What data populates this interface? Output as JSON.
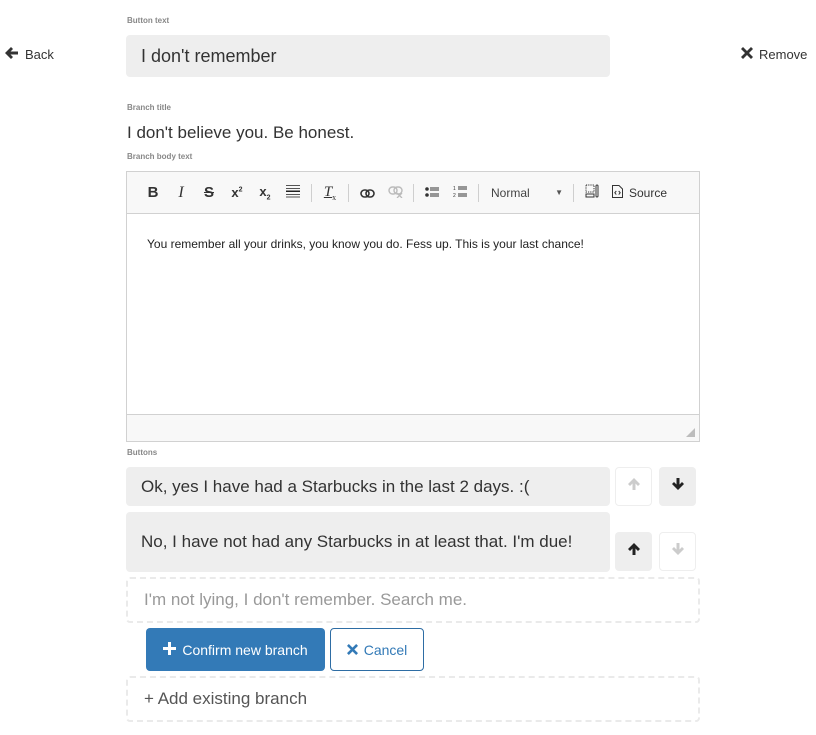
{
  "nav": {
    "back_label": "Back",
    "back_icon": "arrow-left-icon",
    "remove_label": "Remove",
    "remove_icon": "close-icon"
  },
  "form": {
    "button_text_label": "Button text",
    "button_text_value": "I don't remember",
    "branch_title_label": "Branch title",
    "branch_title_value": "I don't believe you. Be honest.",
    "branch_body_label": "Branch body text",
    "buttons_label": "Buttons"
  },
  "editor": {
    "toolbar": [
      {
        "name": "bold",
        "glyph": "B"
      },
      {
        "name": "italic",
        "glyph": "I"
      },
      {
        "name": "strikethrough",
        "glyph": "S"
      },
      {
        "name": "superscript",
        "glyph": "x²"
      },
      {
        "name": "subscript",
        "glyph": "x₂"
      },
      {
        "name": "horizontal-rule",
        "glyph": "≡"
      },
      {
        "name": "remove-format",
        "glyph": "Tx"
      },
      {
        "name": "link",
        "glyph": "link"
      },
      {
        "name": "unlink",
        "glyph": "unlink",
        "disabled": true
      },
      {
        "name": "bulleted-list",
        "glyph": "•≡"
      },
      {
        "name": "numbered-list",
        "glyph": "1≡"
      }
    ],
    "format_select_value": "Normal",
    "source_label": "Source",
    "body_text": "You remember all your drinks, you know you do. Fess up. This is your last chance!"
  },
  "branches": [
    {
      "text": "Ok, yes I have had a Starbucks in the last 2 days. :(",
      "can_move_up": false,
      "can_move_down": true
    },
    {
      "text": "No, I have not had any Starbucks in at least that. I'm due!",
      "can_move_up": true,
      "can_move_down": false
    }
  ],
  "new_branch": {
    "placeholder": "I'm not lying, I don't remember. Search me.",
    "confirm_label": "Confirm new branch",
    "cancel_label": "Cancel"
  },
  "add_existing_label": "+ Add existing branch",
  "colors": {
    "primary": "#337ab7",
    "input_bg": "#eeeeee",
    "text": "#333333"
  }
}
